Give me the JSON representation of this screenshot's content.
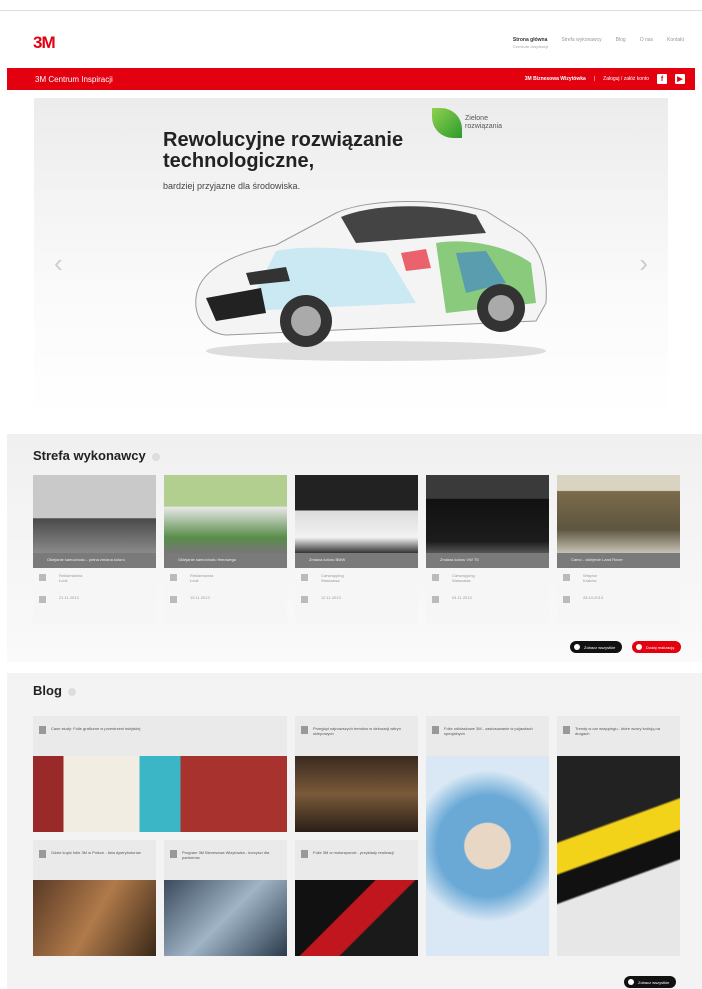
{
  "brand": {
    "logo": "3M"
  },
  "nav": {
    "items": [
      {
        "label": "Strona główna",
        "sub": "Centrum Inspiracji",
        "active": true
      },
      {
        "label": "Strefa wykonawcy",
        "sub": ""
      },
      {
        "label": "Blog",
        "sub": ""
      },
      {
        "label": "O nas",
        "sub": ""
      },
      {
        "label": "Kontakt",
        "sub": ""
      }
    ]
  },
  "redbar": {
    "title": "3M Centrum Inspiracji",
    "partner_label": "3M Biznesowa Wizytówka",
    "login_label": "Zaloguj / załóż konto",
    "facebook_glyph": "f",
    "youtube_glyph": "▶"
  },
  "hero": {
    "headline_line1": "Rewolucyjne rozwiązanie",
    "headline_line2": "technologiczne,",
    "subline": "bardziej przyjazne dla środowiska.",
    "badge_text": "Zielone rozwiązania",
    "prev_glyph": "‹",
    "next_glyph": "›"
  },
  "contractors": {
    "title": "Strefa wykonawcy",
    "cards": [
      {
        "caption": "Oklejanie samochodu - pełna zmiana koloru",
        "company": "Reklamiarnia",
        "city": "Łódź",
        "date": "21.11.2013",
        "photo": [
          "#c9c9c9",
          "#4a4a4a"
        ]
      },
      {
        "caption": "Oklejanie samochodu firmowego",
        "company": "Reklamiarnia",
        "city": "Łódź",
        "date": "19.11.2013",
        "photo": [
          "#9cbf74",
          "#5a8d4a"
        ]
      },
      {
        "caption": "Zmiana koloru BMW",
        "company": "Carwrapping",
        "city": "Warszawa",
        "date": "12.11.2013",
        "photo": [
          "#222",
          "#dcdcdc"
        ]
      },
      {
        "caption": "Zmiana koloru VW T5",
        "company": "Carwrapping",
        "city": "Warszawa",
        "date": "04.11.2013",
        "photo": [
          "#2b2b2b",
          "#111"
        ]
      },
      {
        "caption": "Camo - oklejenie Land Rover",
        "company": "Wraptor",
        "city": "Kraków",
        "date": "28.10.2013",
        "photo": [
          "#d9d3c1",
          "#7a6a4a"
        ]
      }
    ],
    "btn_all": "Zobacz wszystkie",
    "btn_add": "Dodaj realizację"
  },
  "blog": {
    "title": "Blog",
    "tiles": [
      {
        "text": "Case study: Folie graficzne w przestrzeni miejskiej"
      },
      {
        "text": "Przegląd najnowszych trendów w dekoracji witryn sklepowych"
      },
      {
        "text": "Folie odblaskowe 3M - zastosowanie w pojazdach specjalnych"
      },
      {
        "text": "Trendy w car wrappingu - które wzory królują na drogach"
      },
      {
        "text": "Gdzie kupić folie 3M w Polsce - lista dystrybutorów"
      },
      {
        "text": "Program 3M Biznesowa Wizytówka - korzyści dla partnerów"
      },
      {
        "text": "Folie 3M w motorsporcie - przykłady realizacji"
      }
    ],
    "btn_all": "Zobacz wszystkie"
  },
  "colors": {
    "brand_red": "#e3000f",
    "bg_grey": "#f3f3f3"
  }
}
